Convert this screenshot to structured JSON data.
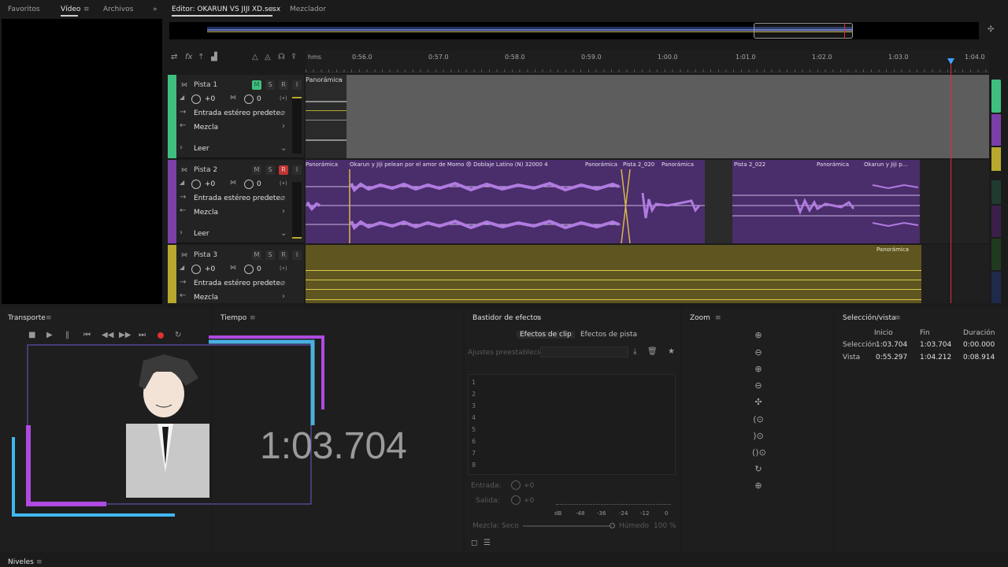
{
  "top_tabs_left": {
    "favorites": "Favoritos",
    "video": "Vídeo",
    "files": "Archivos",
    "more": "»"
  },
  "editor": {
    "tab_title": "Editor: OKARUN VS JIJI XD.sesx",
    "mixer_tab": "Mezclador"
  },
  "ruler": {
    "ticks": [
      "hms",
      "0:56.0",
      "0:57.0",
      "0:58.0",
      "0:59.0",
      "1:00.0",
      "1:01.0",
      "1:02.0",
      "1:03.0",
      "1:04.0"
    ]
  },
  "tracks": [
    {
      "name": "Pista 1",
      "volume": "+0",
      "pan": "0",
      "input": "Entrada estéreo predete",
      "output": "Mezcla",
      "automation": "Leer",
      "color": "#3fbf7f",
      "clip_label": "Panorámica"
    },
    {
      "name": "Pista 2",
      "volume": "+0",
      "pan": "0",
      "input": "Entrada estéreo predete",
      "output": "Mezcla",
      "automation": "Leer",
      "color": "#7b3fa8",
      "clips": [
        {
          "title": "Okarun y Jiji pelean por el amor de Momo 😠 Doblaje Latino (N) 32000 4",
          "pan": "Panorámica"
        },
        {
          "title": "Pista 2_020",
          "pan": "Panorámica"
        },
        {
          "title": "Pista 2_022",
          "pan": "Panorámica"
        },
        {
          "title": "Okarun y Jiji p...",
          "pan": ""
        }
      ]
    },
    {
      "name": "Pista 3",
      "volume": "+0",
      "pan": "0",
      "input": "Entrada estéreo predete",
      "output": "Mezcla",
      "color": "#b8a82e",
      "clip_label": "Panorámica"
    }
  ],
  "track_buttons": {
    "mute": "M",
    "solo": "S",
    "record": "R",
    "input": "I"
  },
  "transport": {
    "title": "Transporte"
  },
  "time": {
    "title": "Tiempo",
    "display": "1:03.704"
  },
  "effects": {
    "title": "Bastidor de efectos",
    "tab_clip": "Efectos de clip",
    "tab_track": "Efectos de pista",
    "presets": "Ajustes preestablecidos:",
    "slots": [
      "1",
      "2",
      "3",
      "4",
      "5",
      "6",
      "7",
      "8"
    ],
    "input_label": "Entrada:",
    "input_value": "+0",
    "output_label": "Salida:",
    "output_value": "+0",
    "meter_ticks": [
      "dB",
      "-48",
      "-36",
      "-24",
      "-12",
      "0"
    ],
    "mix_label": "Mezcla:",
    "mix_dry": "Seco",
    "mix_wet": "Húmedo",
    "mix_value": "100 %"
  },
  "zoom": {
    "title": "Zoom"
  },
  "selection": {
    "title": "Selección/vista",
    "col_start": "Inicio",
    "col_end": "Fin",
    "col_duration": "Duración",
    "rows": [
      {
        "label": "Selección",
        "start": "1:03.704",
        "end": "1:03.704",
        "duration": "0:00.000"
      },
      {
        "label": "Vista",
        "start": "0:55.297",
        "end": "1:04.212",
        "duration": "0:08.914"
      }
    ]
  },
  "levels": {
    "title": "Niveles"
  }
}
